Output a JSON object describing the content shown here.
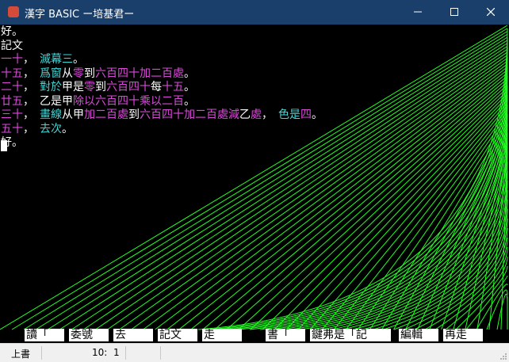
{
  "window": {
    "title": "漢字 BASIC ー培基君ー",
    "titlebar_color": "#1a3f6b"
  },
  "console": {
    "background": "#000000",
    "net_color": "#22ff22",
    "lines": [
      [
        {
          "t": "好。",
          "c": "w"
        }
      ],
      [
        {
          "t": "記文",
          "c": "w"
        }
      ],
      [
        {
          "t": "一十",
          "c": "m"
        },
        {
          "t": "，　",
          "c": "w"
        },
        {
          "t": "滅幕三",
          "c": "c"
        },
        {
          "t": "。",
          "c": "w"
        }
      ],
      [
        {
          "t": "十五",
          "c": "m"
        },
        {
          "t": "，　",
          "c": "w"
        },
        {
          "t": "爲窗",
          "c": "c"
        },
        {
          "t": "从",
          "c": "w"
        },
        {
          "t": "零",
          "c": "m"
        },
        {
          "t": "到",
          "c": "w"
        },
        {
          "t": "六百四十加二百處",
          "c": "m"
        },
        {
          "t": "。",
          "c": "w"
        }
      ],
      [
        {
          "t": "二十",
          "c": "m"
        },
        {
          "t": "，　",
          "c": "w"
        },
        {
          "t": "對於",
          "c": "c"
        },
        {
          "t": "甲是",
          "c": "w"
        },
        {
          "t": "零",
          "c": "m"
        },
        {
          "t": "到",
          "c": "w"
        },
        {
          "t": "六百四十",
          "c": "m"
        },
        {
          "t": "每",
          "c": "w"
        },
        {
          "t": "十五",
          "c": "m"
        },
        {
          "t": "。",
          "c": "w"
        }
      ],
      [
        {
          "t": "廿五",
          "c": "m"
        },
        {
          "t": "，　",
          "c": "w"
        },
        {
          "t": "乙是甲",
          "c": "w"
        },
        {
          "t": "除以六百四十乘以二百",
          "c": "m"
        },
        {
          "t": "。",
          "c": "w"
        }
      ],
      [
        {
          "t": "三十",
          "c": "m"
        },
        {
          "t": "，　",
          "c": "w"
        },
        {
          "t": "畫線",
          "c": "c"
        },
        {
          "t": "从甲",
          "c": "w"
        },
        {
          "t": "加二百處",
          "c": "m"
        },
        {
          "t": "到",
          "c": "w"
        },
        {
          "t": "六百四十加二百處減",
          "c": "m"
        },
        {
          "t": "乙",
          "c": "w"
        },
        {
          "t": "處",
          "c": "m"
        },
        {
          "t": "，　",
          "c": "w"
        },
        {
          "t": "色是",
          "c": "c"
        },
        {
          "t": "四",
          "c": "m"
        },
        {
          "t": "。",
          "c": "w"
        }
      ],
      [
        {
          "t": "五十",
          "c": "m"
        },
        {
          "t": "，　",
          "c": "w"
        },
        {
          "t": "去次",
          "c": "c"
        },
        {
          "t": "。",
          "c": "w"
        }
      ],
      [
        {
          "t": "好。",
          "c": "w"
        }
      ]
    ]
  },
  "function_keys": [
    {
      "label": "讀「"
    },
    {
      "label": "委號"
    },
    {
      "label": "去"
    },
    {
      "label": "記文"
    },
    {
      "label": "走"
    },
    {
      "label": "書「"
    },
    {
      "label": "鍵弗是「記"
    },
    {
      "label": "編輯"
    },
    {
      "label": "再走"
    }
  ],
  "statusbar": {
    "mode": "上書",
    "line": "10:",
    "col": "1"
  }
}
